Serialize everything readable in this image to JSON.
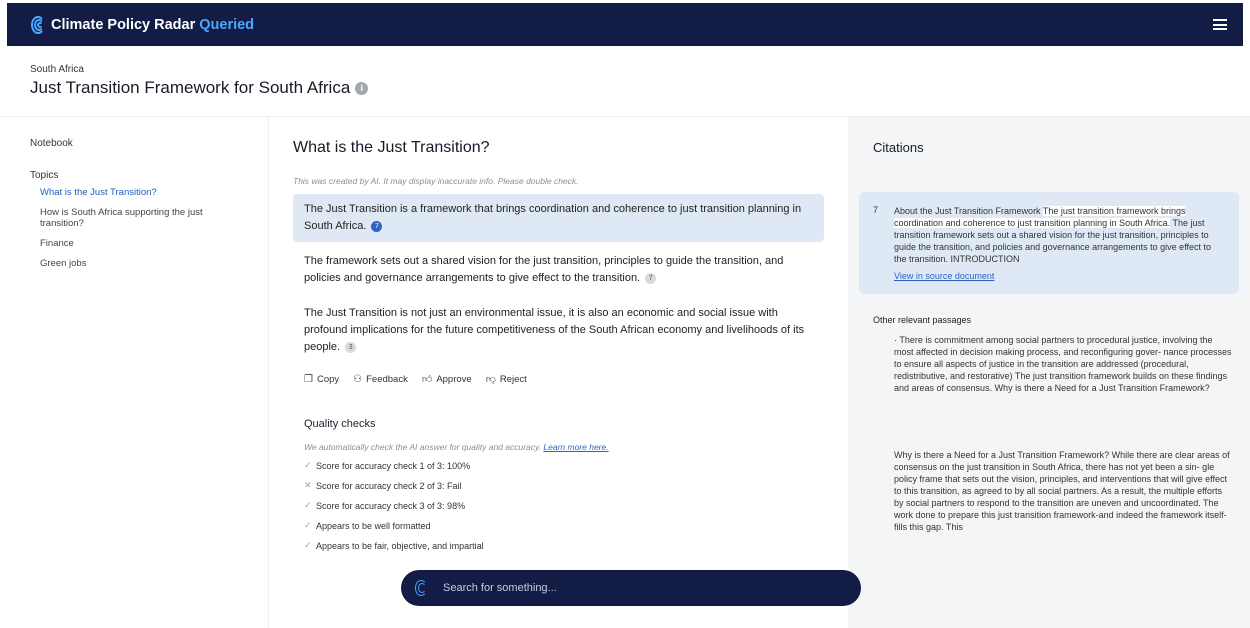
{
  "header": {
    "brand": "Climate Policy Radar",
    "brand_accent": "Queried",
    "menu_icon": "hamburger-menu-icon"
  },
  "document": {
    "country": "South Africa",
    "title": "Just Transition Framework for South Africa",
    "info_icon": "i"
  },
  "sidebar": {
    "notebook_label": "Notebook",
    "topics_label": "Topics",
    "topics": [
      {
        "label": "What is the Just Transition?",
        "active": true
      },
      {
        "label": "How is South Africa supporting the just transition?",
        "active": false
      },
      {
        "label": "Finance",
        "active": false
      },
      {
        "label": "Green jobs",
        "active": false
      }
    ]
  },
  "answer": {
    "question": "What is the Just Transition?",
    "ai_notice": "This was created by AI. It may display inaccurate info. Please double check.",
    "paragraphs": [
      {
        "text": "The Just Transition is a framework that brings coordination and coherence to just transition planning in South Africa.",
        "citation": "7",
        "highlighted": true
      },
      {
        "text": "The framework sets out a shared vision for the just transition, principles to guide the transition, and policies and governance arrangements to give effect to the transition.",
        "citation": "7",
        "highlighted": false
      },
      {
        "text": "The Just Transition is not just an environmental issue, it is also an economic and social issue with profound implications for the future competitiveness of the South African economy and livelihoods of its people.",
        "citation": "3",
        "highlighted": false
      }
    ],
    "actions": {
      "copy": "Copy",
      "feedback": "Feedback",
      "approve": "Approve",
      "reject": "Reject"
    }
  },
  "quality": {
    "title": "Quality checks",
    "note": "We automatically check the AI answer for quality and accuracy.",
    "learn_more": "Learn more here.",
    "checks": [
      {
        "icon": "✓",
        "text": "Score for accuracy check 1 of 3: 100%"
      },
      {
        "icon": "✕",
        "text": "Score for accuracy check 2 of 3: Fail"
      },
      {
        "icon": "✓",
        "text": "Score for accuracy check 3 of 3: 98%"
      },
      {
        "icon": "✓",
        "text": "Appears to be well formatted"
      },
      {
        "icon": "✓",
        "text": "Appears to be fair, objective, and impartial"
      }
    ]
  },
  "search": {
    "placeholder": "Search for something..."
  },
  "citations": {
    "title": "Citations",
    "card": {
      "number": "7",
      "lead": "About the Just Transition Framework ",
      "marked": "The just transition framework brings coordination and coherence to just transition planning in South Africa.",
      "rest": " The just transition framework sets out a shared vision for the just transition, principles to guide the transition, and policies and governance arrangements to give effect to the transition. INTRODUCTION",
      "link": "View in source document"
    },
    "other_title": "Other relevant passages",
    "passages": [
      "· There is commitment among social partners to procedural justice, involving the most affected in decision making process, and reconfiguring gover- nance processes to ensure all aspects of justice in the transition are addressed (procedural, redistributive, and restorative) The just transition framework builds on these findings and areas of consensus. Why is there a Need for a Just Transition Framework?",
      "Why is there a Need for a Just Transition Framework? While there are clear areas of consensus on the just transition in South Africa, there has not yet been a sin- gle policy frame that sets out the vision, principles, and interventions that will give effect to this transition, as agreed to by all social partners. As a result, the multiple efforts by social partners to respond to the transition are uneven and uncoordinated. The work done to prepare this just transition framework-and indeed the framework itself-fills this gap. This"
    ]
  }
}
